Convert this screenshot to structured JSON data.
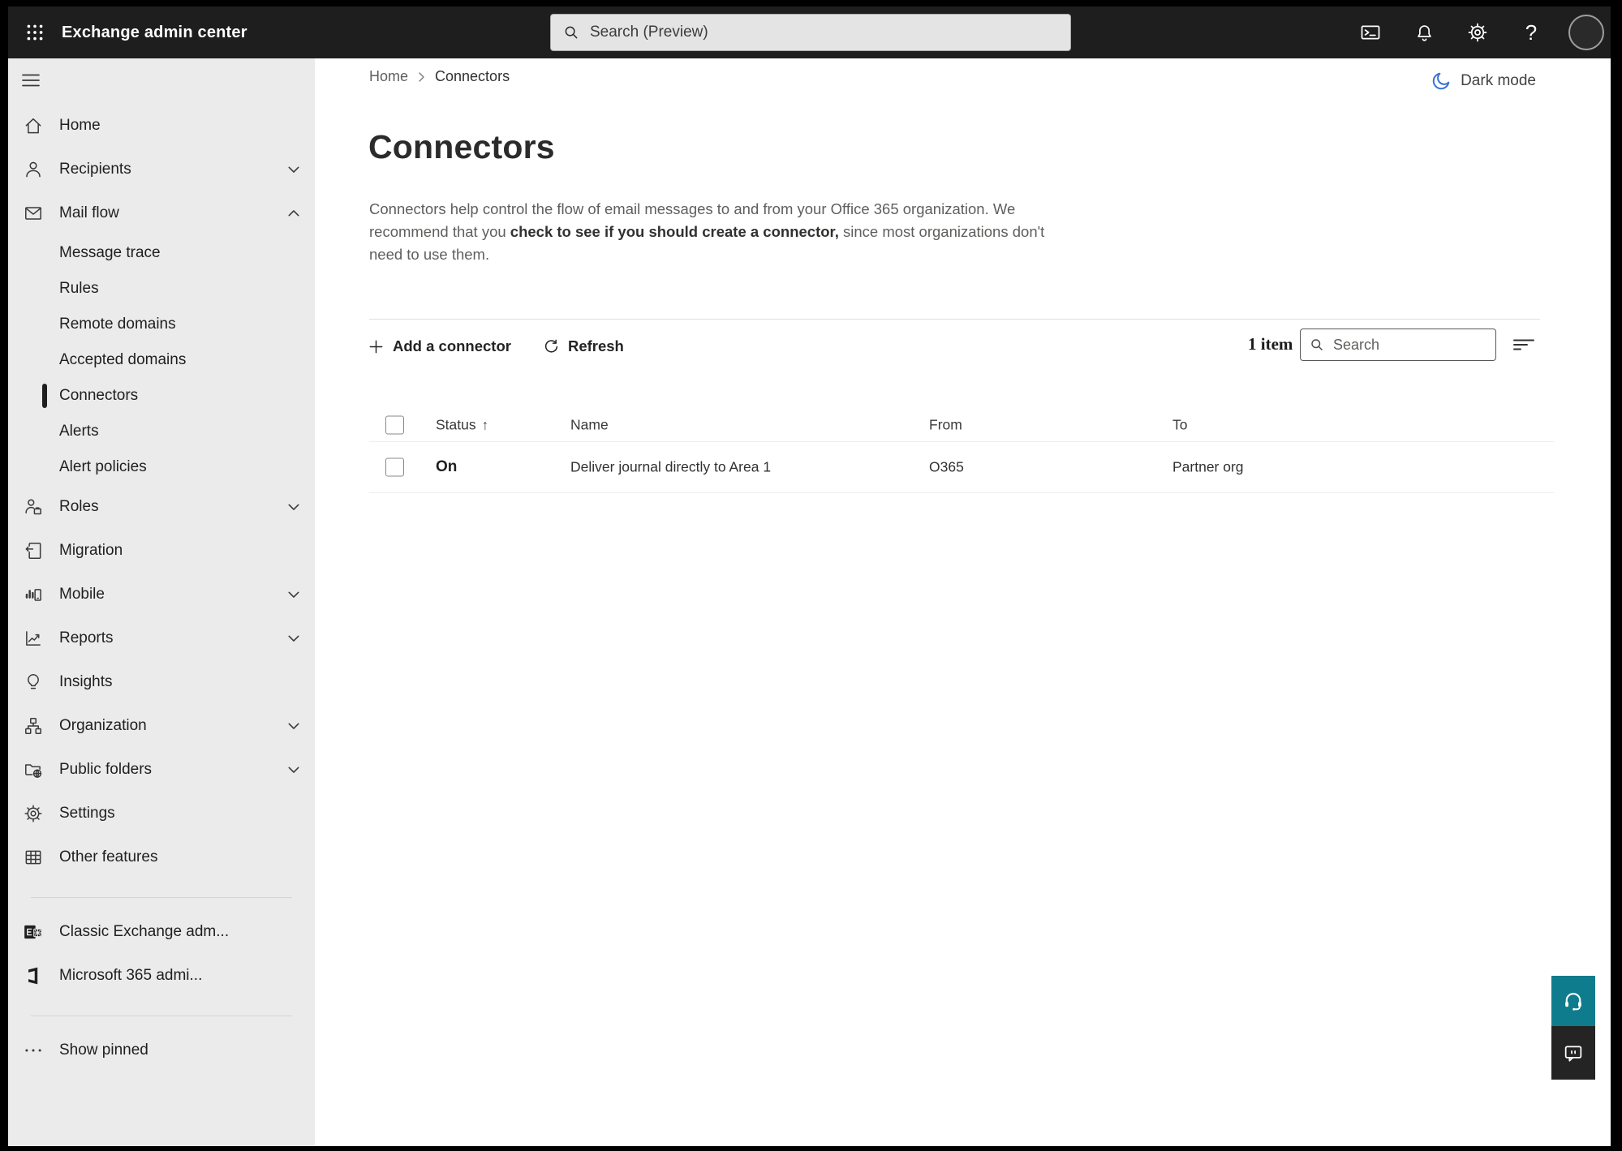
{
  "topbar": {
    "app_title": "Exchange admin center",
    "search_placeholder": "Search (Preview)"
  },
  "sidebar": {
    "items": [
      {
        "label": "Home"
      },
      {
        "label": "Recipients"
      },
      {
        "label": "Mail flow"
      },
      {
        "label": "Message trace"
      },
      {
        "label": "Rules"
      },
      {
        "label": "Remote domains"
      },
      {
        "label": "Accepted domains"
      },
      {
        "label": "Connectors"
      },
      {
        "label": "Alerts"
      },
      {
        "label": "Alert policies"
      },
      {
        "label": "Roles"
      },
      {
        "label": "Migration"
      },
      {
        "label": "Mobile"
      },
      {
        "label": "Reports"
      },
      {
        "label": "Insights"
      },
      {
        "label": "Organization"
      },
      {
        "label": "Public folders"
      },
      {
        "label": "Settings"
      },
      {
        "label": "Other features"
      }
    ],
    "footer_items": [
      {
        "label": "Classic Exchange adm..."
      },
      {
        "label": "Microsoft 365 admi..."
      }
    ],
    "show_pinned": "Show pinned"
  },
  "breadcrumb": {
    "home": "Home",
    "current": "Connectors"
  },
  "dark_mode_label": "Dark mode",
  "page": {
    "title": "Connectors",
    "description_pre": "Connectors help control the flow of email messages to and from your Office 365 organization. We recommend that you ",
    "description_link": "check to see if you should create a connector,",
    "description_post": " since most organizations don't need to use them."
  },
  "toolbar": {
    "add_label": "Add a connector",
    "refresh_label": "Refresh",
    "item_count": "1 item",
    "search_placeholder": "Search"
  },
  "table": {
    "headers": {
      "status": "Status",
      "name": "Name",
      "from": "From",
      "to": "To"
    },
    "sort_arrow": "↑",
    "rows": [
      {
        "status": "On",
        "name": "Deliver journal directly to Area 1",
        "from": "O365",
        "to": "Partner org"
      }
    ]
  },
  "colors": {
    "topbar_bg": "#1e1e1e",
    "sidebar_bg": "#ebebeb",
    "accent_teal": "#0e7c8c",
    "darkmode_moon_blue": "#3a73d4",
    "selected_indicator": "#1f1f1f"
  }
}
